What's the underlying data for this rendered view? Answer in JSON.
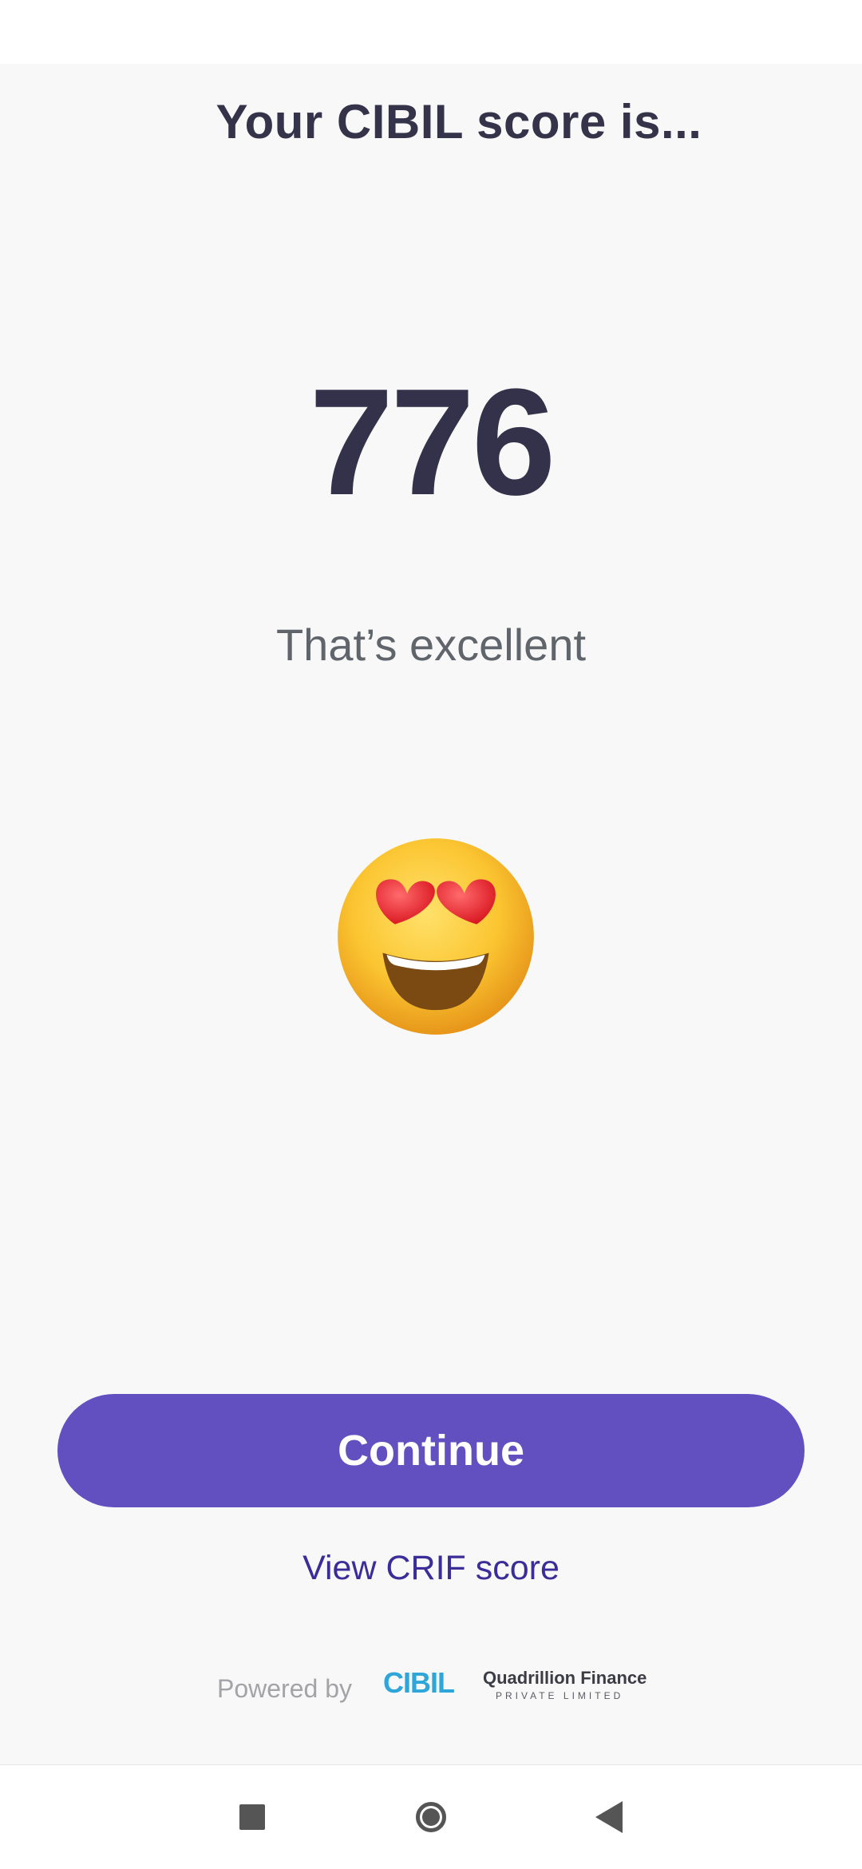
{
  "header": {
    "title": "Your CIBIL score is..."
  },
  "score": {
    "value": "776",
    "description": "That’s excellent",
    "emoji_icon": "heart-eyes-emoji-icon"
  },
  "actions": {
    "continue_label": "Continue",
    "crif_link_label": "View CRIF score"
  },
  "footer": {
    "powered_by_label": "Powered by",
    "partner_logos": [
      "CIBIL",
      "Quadrillion Finance PRIVATE LIMITED"
    ]
  },
  "colors": {
    "primary": "#6250c1",
    "link": "#3a2d99",
    "score_text": "#33324a",
    "background": "#f8f8f8"
  },
  "nav": {
    "icons": [
      "recents-icon",
      "home-icon",
      "back-icon"
    ]
  }
}
